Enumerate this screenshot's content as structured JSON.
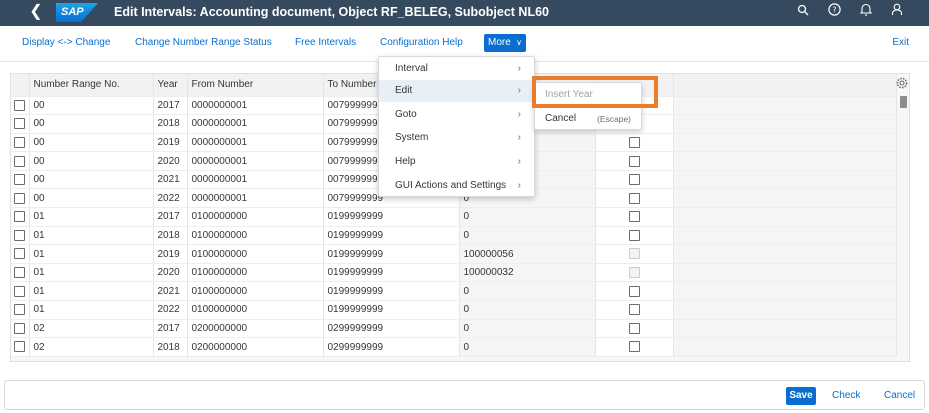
{
  "shell": {
    "back_icon": "back-icon",
    "logo_text": "SAP",
    "title": "Edit Intervals: Accounting document, Object RF_BELEG, Subobject NL60",
    "icons": [
      "search-icon",
      "help-icon",
      "notifications-icon",
      "user-icon"
    ]
  },
  "toolbar": {
    "display_change": "Display <-> Change",
    "change_status": "Change Number Range Status",
    "free_intervals": "Free Intervals",
    "config_help": "Configuration Help",
    "more": "More",
    "exit": "Exit"
  },
  "table": {
    "headers": [
      "Number Range No.",
      "Year",
      "From Number",
      "To Number",
      "",
      ""
    ],
    "rows": [
      {
        "no": "00",
        "year": "2017",
        "from": "0000000001",
        "to": "0079999999",
        "status": "",
        "ext": "false"
      },
      {
        "no": "00",
        "year": "2018",
        "from": "0000000001",
        "to": "0079999999",
        "status": "",
        "ext": "false"
      },
      {
        "no": "00",
        "year": "2019",
        "from": "0000000001",
        "to": "0079999999",
        "status": "",
        "ext": "false"
      },
      {
        "no": "00",
        "year": "2020",
        "from": "0000000001",
        "to": "0079999999",
        "status": "",
        "ext": "false"
      },
      {
        "no": "00",
        "year": "2021",
        "from": "0000000001",
        "to": "0079999999",
        "status": "",
        "ext": "false"
      },
      {
        "no": "00",
        "year": "2022",
        "from": "0000000001",
        "to": "0079999999",
        "status": "0",
        "ext": "false"
      },
      {
        "no": "01",
        "year": "2017",
        "from": "0100000000",
        "to": "0199999999",
        "status": "0",
        "ext": "false"
      },
      {
        "no": "01",
        "year": "2018",
        "from": "0100000000",
        "to": "0199999999",
        "status": "0",
        "ext": "false"
      },
      {
        "no": "01",
        "year": "2019",
        "from": "0100000000",
        "to": "0199999999",
        "status": "100000056",
        "ext": "disabled"
      },
      {
        "no": "01",
        "year": "2020",
        "from": "0100000000",
        "to": "0199999999",
        "status": "100000032",
        "ext": "disabled"
      },
      {
        "no": "01",
        "year": "2021",
        "from": "0100000000",
        "to": "0199999999",
        "status": "0",
        "ext": "false"
      },
      {
        "no": "01",
        "year": "2022",
        "from": "0100000000",
        "to": "0199999999",
        "status": "0",
        "ext": "false"
      },
      {
        "no": "02",
        "year": "2017",
        "from": "0200000000",
        "to": "0299999999",
        "status": "0",
        "ext": "false"
      },
      {
        "no": "02",
        "year": "2018",
        "from": "0200000000",
        "to": "0299999999",
        "status": "0",
        "ext": "false"
      }
    ]
  },
  "menu": {
    "items": [
      {
        "label": "Interval"
      },
      {
        "label": "Edit"
      },
      {
        "label": "Goto"
      },
      {
        "label": "System"
      },
      {
        "label": "Help"
      },
      {
        "label": "GUI Actions and Settings"
      }
    ]
  },
  "submenu": {
    "insert_year": "Insert Year",
    "cancel": "Cancel",
    "cancel_shortcut": "(Escape)"
  },
  "footer": {
    "save": "Save",
    "check": "Check",
    "cancel": "Cancel"
  },
  "colors": {
    "shell_bg": "#354a5f",
    "accent": "#0a6ed1",
    "highlight": "#e87d2b"
  }
}
